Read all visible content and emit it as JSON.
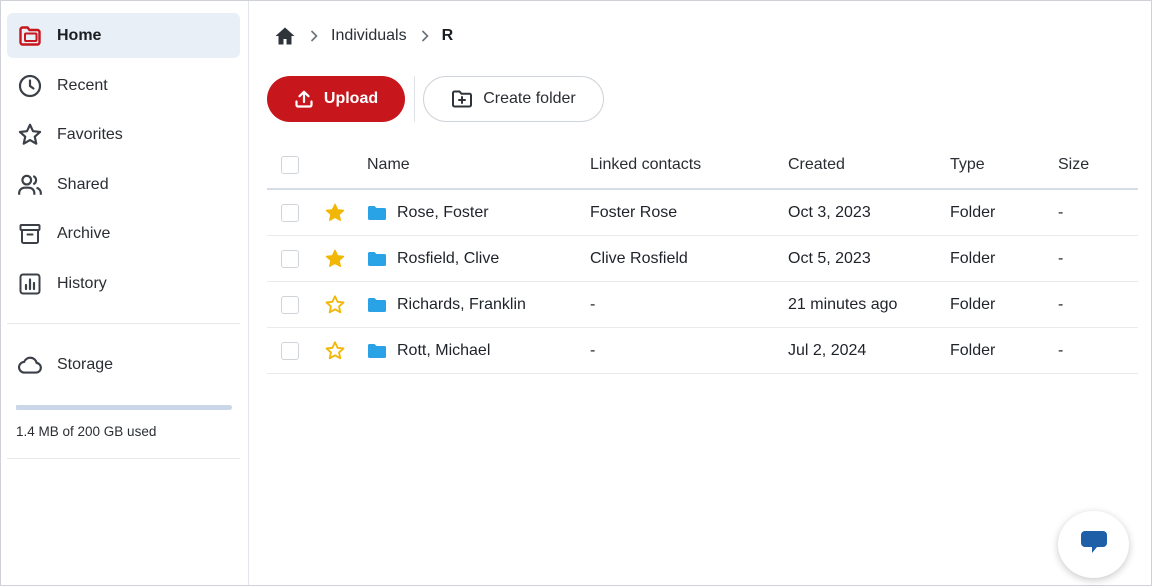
{
  "colors": {
    "accent": "#c8161d",
    "folder": "#2aa3e6",
    "star": "#f2b705",
    "chat": "#1f5fa8"
  },
  "sidebar": {
    "items": [
      {
        "label": "Home",
        "icon": "home-folder-icon",
        "active": true
      },
      {
        "label": "Recent",
        "icon": "clock-icon"
      },
      {
        "label": "Favorites",
        "icon": "star-icon"
      },
      {
        "label": "Shared",
        "icon": "users-icon"
      },
      {
        "label": "Archive",
        "icon": "archive-box-icon"
      },
      {
        "label": "History",
        "icon": "chart-icon"
      }
    ],
    "storage": {
      "label": "Storage",
      "icon": "cloud-icon",
      "usage_text": "1.4 MB of 200 GB used",
      "used_fraction": 1e-05
    }
  },
  "breadcrumb": {
    "home_icon": "home-icon",
    "items": [
      "Individuals",
      "R"
    ]
  },
  "toolbar": {
    "upload_label": "Upload",
    "create_folder_label": "Create folder"
  },
  "table": {
    "columns": {
      "name": "Name",
      "linked": "Linked contacts",
      "created": "Created",
      "type": "Type",
      "size": "Size"
    },
    "rows": [
      {
        "name": "Rose, Foster",
        "linked": "Foster Rose",
        "created": "Oct 3, 2023",
        "type": "Folder",
        "size": "-",
        "starred": true
      },
      {
        "name": "Rosfield, Clive",
        "linked": "Clive Rosfield",
        "created": "Oct 5, 2023",
        "type": "Folder",
        "size": "-",
        "starred": true
      },
      {
        "name": "Richards, Franklin",
        "linked": "-",
        "created": "21 minutes ago",
        "type": "Folder",
        "size": "-",
        "starred": false
      },
      {
        "name": "Rott, Michael",
        "linked": "-",
        "created": "Jul 2, 2024",
        "type": "Folder",
        "size": "-",
        "starred": false
      }
    ]
  }
}
